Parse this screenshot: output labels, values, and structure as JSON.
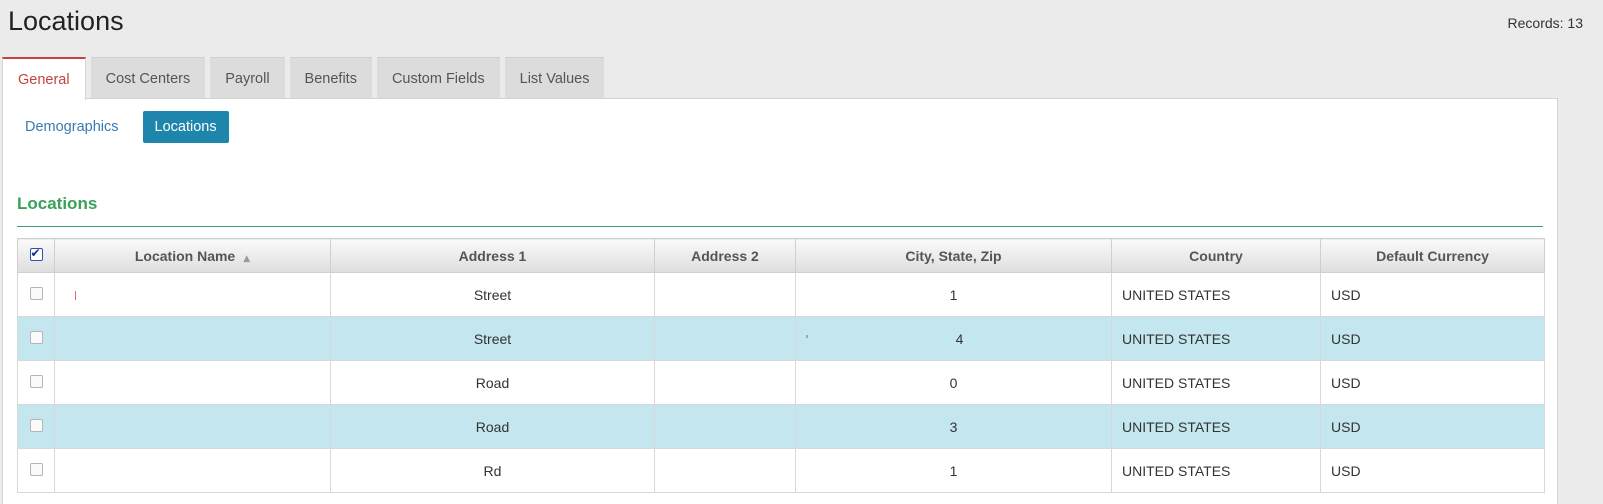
{
  "page": {
    "title": "Locations",
    "records_label": "Records: 13"
  },
  "tabs": [
    {
      "label": "General",
      "active": true
    },
    {
      "label": "Cost Centers"
    },
    {
      "label": "Payroll"
    },
    {
      "label": "Benefits"
    },
    {
      "label": "Custom Fields"
    },
    {
      "label": "List Values"
    }
  ],
  "subtabs": [
    {
      "label": "Demographics"
    },
    {
      "label": "Locations",
      "active": true
    }
  ],
  "section": {
    "title": "Locations"
  },
  "colors": {
    "active_tab": "#c8403f",
    "subtab_active_bg": "#1e86ac",
    "section_title": "#3aa05a",
    "row_alt": "#c3e6ef"
  },
  "table": {
    "columns": [
      "Location Name",
      "Address 1",
      "Address 2",
      "City, State, Zip",
      "Country",
      "Default Currency"
    ],
    "sort_column": "Location Name",
    "sort_icon": "sort-ascending-icon",
    "rows": [
      {
        "name": "",
        "address1": "Street",
        "address2": "",
        "city": "1",
        "country": "UNITED STATES",
        "currency": "USD"
      },
      {
        "name": "",
        "address1": "Street",
        "address2": "",
        "city": "4",
        "country": "UNITED STATES",
        "currency": "USD"
      },
      {
        "name": "",
        "address1": "Road",
        "address2": "",
        "city": "0",
        "country": "UNITED STATES",
        "currency": "USD"
      },
      {
        "name": "",
        "address1": "Road",
        "address2": "",
        "city": "3",
        "country": "UNITED STATES",
        "currency": "USD"
      },
      {
        "name": "",
        "address1": "Rd",
        "address2": "",
        "city": "1",
        "country": "UNITED STATES",
        "currency": "USD"
      }
    ]
  }
}
